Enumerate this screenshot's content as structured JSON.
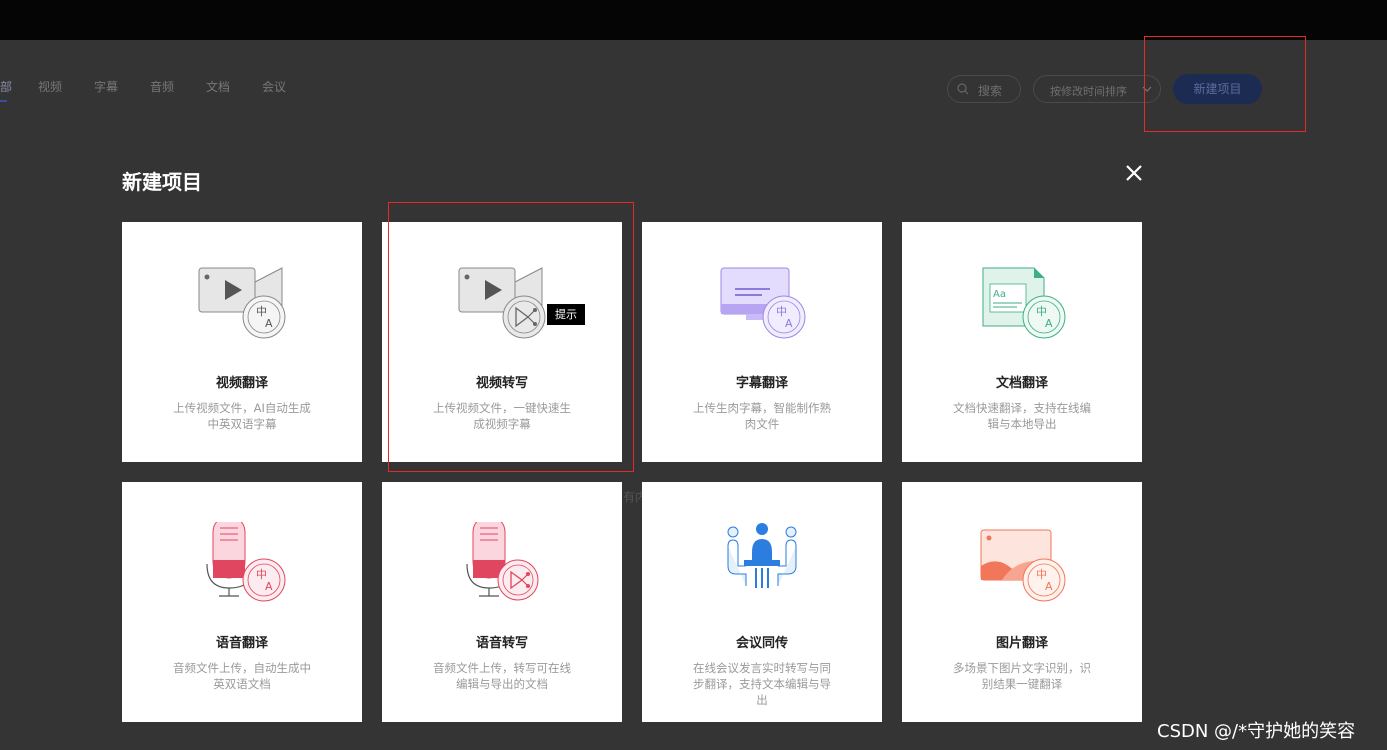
{
  "topbar": {},
  "tabs": [
    {
      "label": "部"
    },
    {
      "label": "视频"
    },
    {
      "label": "字幕"
    },
    {
      "label": "音频"
    },
    {
      "label": "文档"
    },
    {
      "label": "会议"
    }
  ],
  "toolbar": {
    "search_label": "搜索",
    "sort_label": "按修改时间排序",
    "new_project_label": "新建项目"
  },
  "modal": {
    "title": "新建项目",
    "cards": [
      {
        "title": "视频翻译",
        "desc": "上传视频文件，AI自动生成中英双语字幕",
        "icon": "video-translate-icon"
      },
      {
        "title": "视频转写",
        "desc": "上传视频文件，一键快速生成视频字幕",
        "icon": "video-transcribe-icon"
      },
      {
        "title": "字幕翻译",
        "desc": "上传生肉字幕，智能制作熟肉文件",
        "icon": "subtitle-translate-icon"
      },
      {
        "title": "文档翻译",
        "desc": "文档快速翻译，支持在线编辑与本地导出",
        "icon": "document-translate-icon"
      },
      {
        "title": "语音翻译",
        "desc": "音频文件上传，自动生成中英双语文档",
        "icon": "audio-translate-icon"
      },
      {
        "title": "语音转写",
        "desc": "音频文件上传，转写可在线编辑与导出的文档",
        "icon": "audio-transcribe-icon"
      },
      {
        "title": "会议同传",
        "desc": "在线会议发言实时转写与同步翻译，支持文本编辑与导出",
        "icon": "meeting-interpret-icon"
      },
      {
        "title": "图片翻译",
        "desc": "多场景下图片文字识别，识别结果一键翻译",
        "icon": "image-translate-icon"
      }
    ],
    "tooltip": "提示",
    "icon_zh": "中",
    "icon_a": "A",
    "icon_aa": "Aa"
  },
  "background_glyphs": {
    "g1": "有内"
  },
  "watermark": "CSDN @/*守护她的笑容",
  "colors": {
    "backdrop": "#343434",
    "topbar": "#050505",
    "highlight": "#e32a2a",
    "button": "#1b2b52"
  }
}
